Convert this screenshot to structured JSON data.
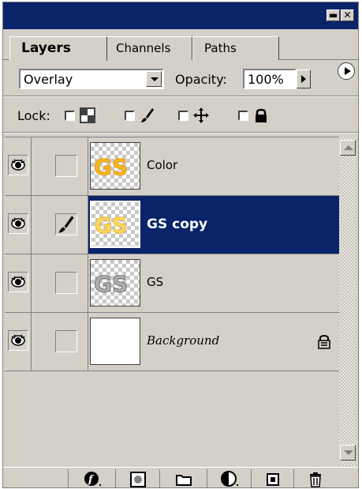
{
  "tabs": [
    {
      "label": "Layers",
      "active": true
    },
    {
      "label": "Channels",
      "active": false
    },
    {
      "label": "Paths",
      "active": false
    }
  ],
  "window_controls": {
    "minimize_glyph": "▬",
    "close_glyph": "✕"
  },
  "blend": {
    "mode": "Overlay",
    "opacity_label": "Opacity:",
    "opacity_value": "100%"
  },
  "lock": {
    "label": "Lock:",
    "options": [
      {
        "icon": "transparency-lock-icon",
        "checked": false
      },
      {
        "icon": "brush-lock-icon",
        "checked": false
      },
      {
        "icon": "move-lock-icon",
        "checked": false
      },
      {
        "icon": "padlock-icon",
        "checked": false
      }
    ]
  },
  "layers": [
    {
      "name": "Color",
      "visible": true,
      "linked_brush": false,
      "selected": false,
      "thumbnail": "gold-logo",
      "locked": false
    },
    {
      "name": "GS copy",
      "visible": true,
      "linked_brush": true,
      "selected": true,
      "thumbnail": "light-gold-logo",
      "locked": false
    },
    {
      "name": "GS",
      "visible": true,
      "linked_brush": false,
      "selected": false,
      "thumbnail": "grey-logo",
      "locked": false
    },
    {
      "name": "Background",
      "visible": true,
      "linked_brush": false,
      "selected": false,
      "thumbnail": "white",
      "locked": true
    }
  ],
  "bottom_toolbar": [
    "add-layer-style-icon",
    "add-mask-icon",
    "new-set-icon",
    "new-adjustment-layer-icon",
    "new-layer-icon",
    "trash-icon"
  ],
  "colors": {
    "selection": "#0a246a",
    "panel": "#d4d0c8",
    "logo_gold": "#f5b820"
  }
}
